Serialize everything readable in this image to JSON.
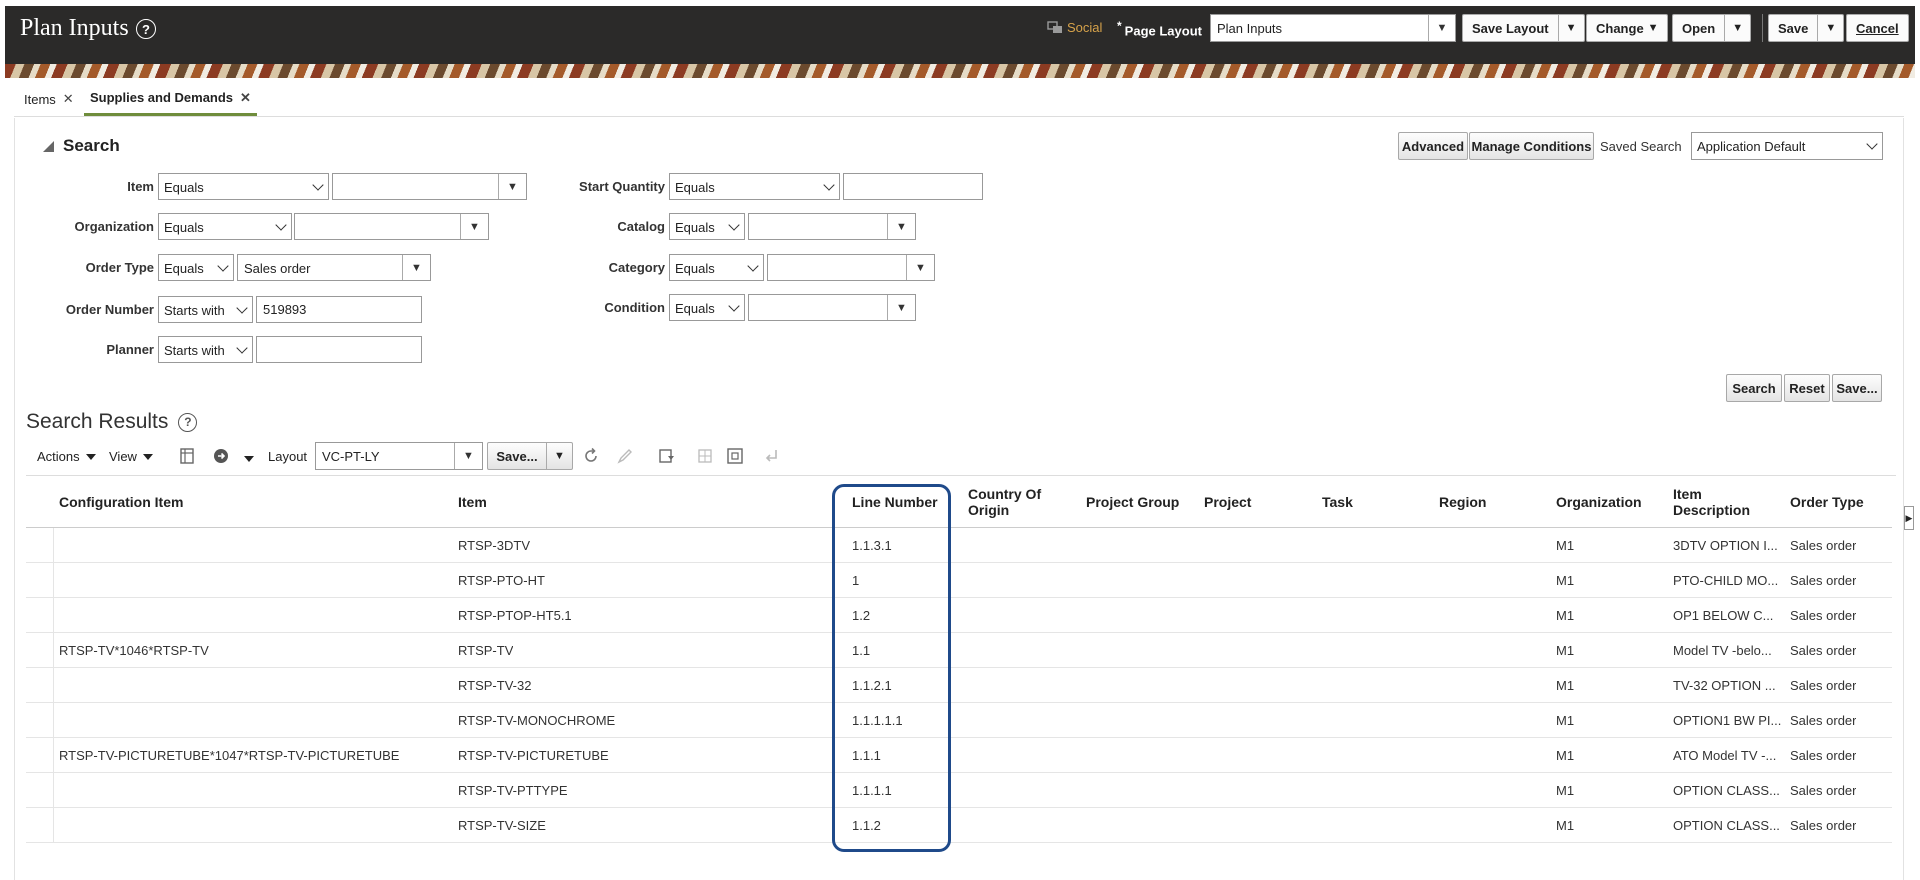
{
  "header": {
    "title": "Plan Inputs",
    "help": "?",
    "social": "Social",
    "page_layout_asterisk": "*",
    "page_layout_label": "Page Layout",
    "page_layout_value": "Plan Inputs",
    "buttons": {
      "save_layout": "Save Layout",
      "change": "Change",
      "open": "Open",
      "save": "Save",
      "cancel": "Cancel"
    }
  },
  "tabs": [
    {
      "label": "Items",
      "active": false
    },
    {
      "label": "Supplies and Demands",
      "active": true
    }
  ],
  "search": {
    "title": "Search",
    "advanced": "Advanced",
    "manage_conditions": "Manage Conditions",
    "saved_search_label": "Saved Search",
    "saved_search_value": "Application Default",
    "fields": {
      "item": {
        "label": "Item",
        "operator": "Equals",
        "value": ""
      },
      "organization": {
        "label": "Organization",
        "operator": "Equals",
        "value": ""
      },
      "order_type": {
        "label": "Order Type",
        "operator": "Equals",
        "value": "Sales order"
      },
      "order_number": {
        "label": "Order Number",
        "operator": "Starts with",
        "value": "519893"
      },
      "planner": {
        "label": "Planner",
        "operator": "Starts with",
        "value": ""
      },
      "start_quantity": {
        "label": "Start Quantity",
        "operator": "Equals",
        "value": ""
      },
      "catalog": {
        "label": "Catalog",
        "operator": "Equals",
        "value": ""
      },
      "category": {
        "label": "Category",
        "operator": "Equals",
        "value": ""
      },
      "condition": {
        "label": "Condition",
        "operator": "Equals",
        "value": ""
      }
    },
    "buttons": {
      "search": "Search",
      "reset": "Reset",
      "save": "Save..."
    }
  },
  "results": {
    "title": "Search Results",
    "toolbar": {
      "actions": "Actions",
      "view": "View",
      "layout_label": "Layout",
      "layout_value": "VC-PT-LY",
      "save": "Save..."
    },
    "columns": {
      "configuration_item": "Configuration Item",
      "item": "Item",
      "line_number": "Line Number",
      "country_of_origin_1": "Country Of",
      "country_of_origin_2": "Origin",
      "project_group": "Project Group",
      "project": "Project",
      "task": "Task",
      "region": "Region",
      "organization": "Organization",
      "item_description_1": "Item",
      "item_description_2": "Description",
      "order_type": "Order Type"
    },
    "rows": [
      {
        "configuration_item": "",
        "item": "RTSP-3DTV",
        "line_number": "1.1.3.1",
        "organization": "M1",
        "item_description": "3DTV OPTION I...",
        "order_type": "Sales order"
      },
      {
        "configuration_item": "",
        "item": "RTSP-PTO-HT",
        "line_number": "1",
        "organization": "M1",
        "item_description": "PTO-CHILD MO...",
        "order_type": "Sales order"
      },
      {
        "configuration_item": "",
        "item": "RTSP-PTOP-HT5.1",
        "line_number": "1.2",
        "organization": "M1",
        "item_description": "OP1 BELOW C...",
        "order_type": "Sales order"
      },
      {
        "configuration_item": "RTSP-TV*1046*RTSP-TV",
        "item": "RTSP-TV",
        "line_number": "1.1",
        "organization": "M1",
        "item_description": "Model TV -belo...",
        "order_type": "Sales order"
      },
      {
        "configuration_item": "",
        "item": "RTSP-TV-32",
        "line_number": "1.1.2.1",
        "organization": "M1",
        "item_description": "TV-32 OPTION ...",
        "order_type": "Sales order"
      },
      {
        "configuration_item": "",
        "item": "RTSP-TV-MONOCHROME",
        "line_number": "1.1.1.1.1",
        "organization": "M1",
        "item_description": "OPTION1 BW PI...",
        "order_type": "Sales order"
      },
      {
        "configuration_item": "RTSP-TV-PICTURETUBE*1047*RTSP-TV-PICTURETUBE",
        "item": "RTSP-TV-PICTURETUBE",
        "line_number": "1.1.1",
        "organization": "M1",
        "item_description": "ATO Model TV -...",
        "order_type": "Sales order"
      },
      {
        "configuration_item": "",
        "item": "RTSP-TV-PTTYPE",
        "line_number": "1.1.1.1",
        "organization": "M1",
        "item_description": "OPTION CLASS...",
        "order_type": "Sales order"
      },
      {
        "configuration_item": "",
        "item": "RTSP-TV-SIZE",
        "line_number": "1.1.2",
        "organization": "M1",
        "item_description": "OPTION CLASS...",
        "order_type": "Sales order"
      }
    ]
  },
  "colors": {
    "header_bg": "#2b2a29",
    "social": "#d6a24a",
    "active_tab": "#6f8d3c",
    "highlight": "#1f4a8a"
  }
}
